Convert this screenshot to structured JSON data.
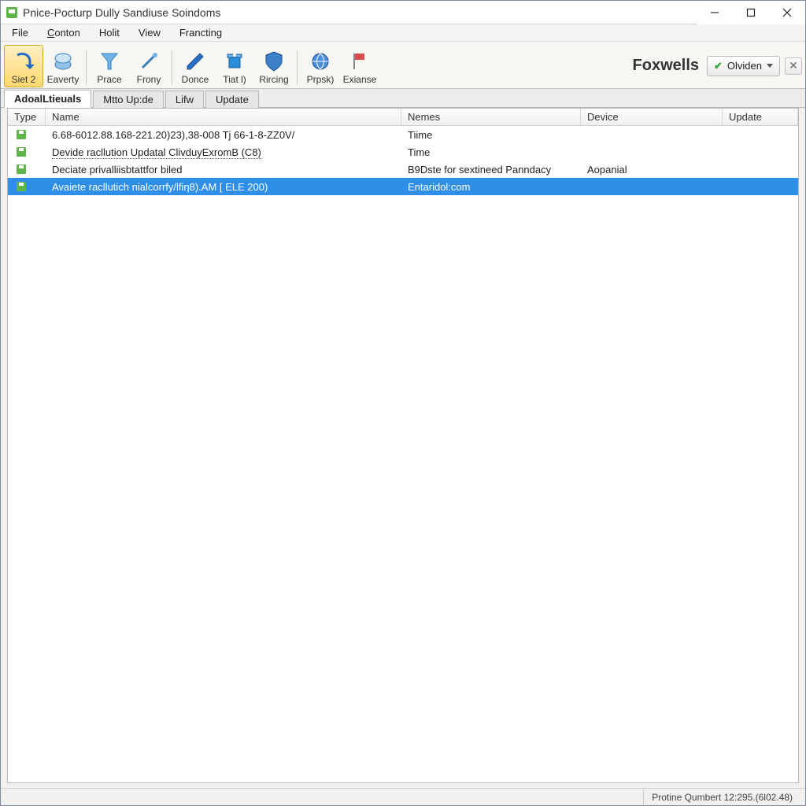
{
  "window": {
    "title": "Pnice-Pocturp Dully Sandiuse Soindoms"
  },
  "menubar": {
    "items": [
      {
        "label": "File"
      },
      {
        "label_pre": "",
        "label_ul": "C",
        "label_post": "onton"
      },
      {
        "label": "Holit"
      },
      {
        "label": "View"
      },
      {
        "label": "Francting"
      }
    ]
  },
  "toolbar": {
    "buttons": [
      {
        "label": "Siet 2",
        "icon": "arrow-icon",
        "active": true
      },
      {
        "label": "Eaverty",
        "icon": "cube-icon"
      },
      {
        "label": "Prace",
        "icon": "filter-icon"
      },
      {
        "label": "Frony",
        "icon": "brush-icon"
      },
      {
        "label": "Donce",
        "icon": "pencil-icon"
      },
      {
        "label": "Tiat l)",
        "icon": "trash-icon"
      },
      {
        "label": "Rircing",
        "icon": "shield-icon"
      },
      {
        "label": "Prpsk)",
        "icon": "globe-icon"
      },
      {
        "label": "Exianse",
        "icon": "flag-icon"
      }
    ],
    "brand": "Foxwells",
    "status": {
      "label": "Olviden"
    }
  },
  "tabs": [
    {
      "label": "AdoalLtieuals",
      "active": true
    },
    {
      "label": "Mtto Up:de"
    },
    {
      "label": "Lifw"
    },
    {
      "label": "Update"
    }
  ],
  "table": {
    "columns": [
      {
        "key": "type",
        "label": "Type"
      },
      {
        "key": "name",
        "label": "Name"
      },
      {
        "key": "nemes",
        "label": "Nemes"
      },
      {
        "key": "device",
        "label": "Device"
      },
      {
        "key": "update",
        "label": "Update"
      }
    ],
    "rows": [
      {
        "name": "6.68-6012.88.168-221.20)23),38-008 Tj 66-1-8-ZZ0V/",
        "nemes": "Tiime",
        "device": "",
        "update": "",
        "underline": false,
        "selected": false
      },
      {
        "name": "Devide racllution Updatal ClivduyExromB (C8)",
        "nemes": "Time",
        "device": "",
        "update": "",
        "underline": true,
        "selected": false
      },
      {
        "name": "Deciate privalliisbtattfor biled",
        "nemes": "B9Dste for sextineed Panndacy",
        "device": "Aopanial",
        "update": "",
        "underline": false,
        "selected": false
      },
      {
        "name": "Avaiete racllutich nialcorrfy/lfiƞ8).AM [ ELE 200)",
        "nemes": "Entaridol:com",
        "device": "",
        "update": "",
        "underline": false,
        "selected": true
      }
    ]
  },
  "statusbar": {
    "text": "Protine Qumbert 12:295.(6l02.48)"
  }
}
